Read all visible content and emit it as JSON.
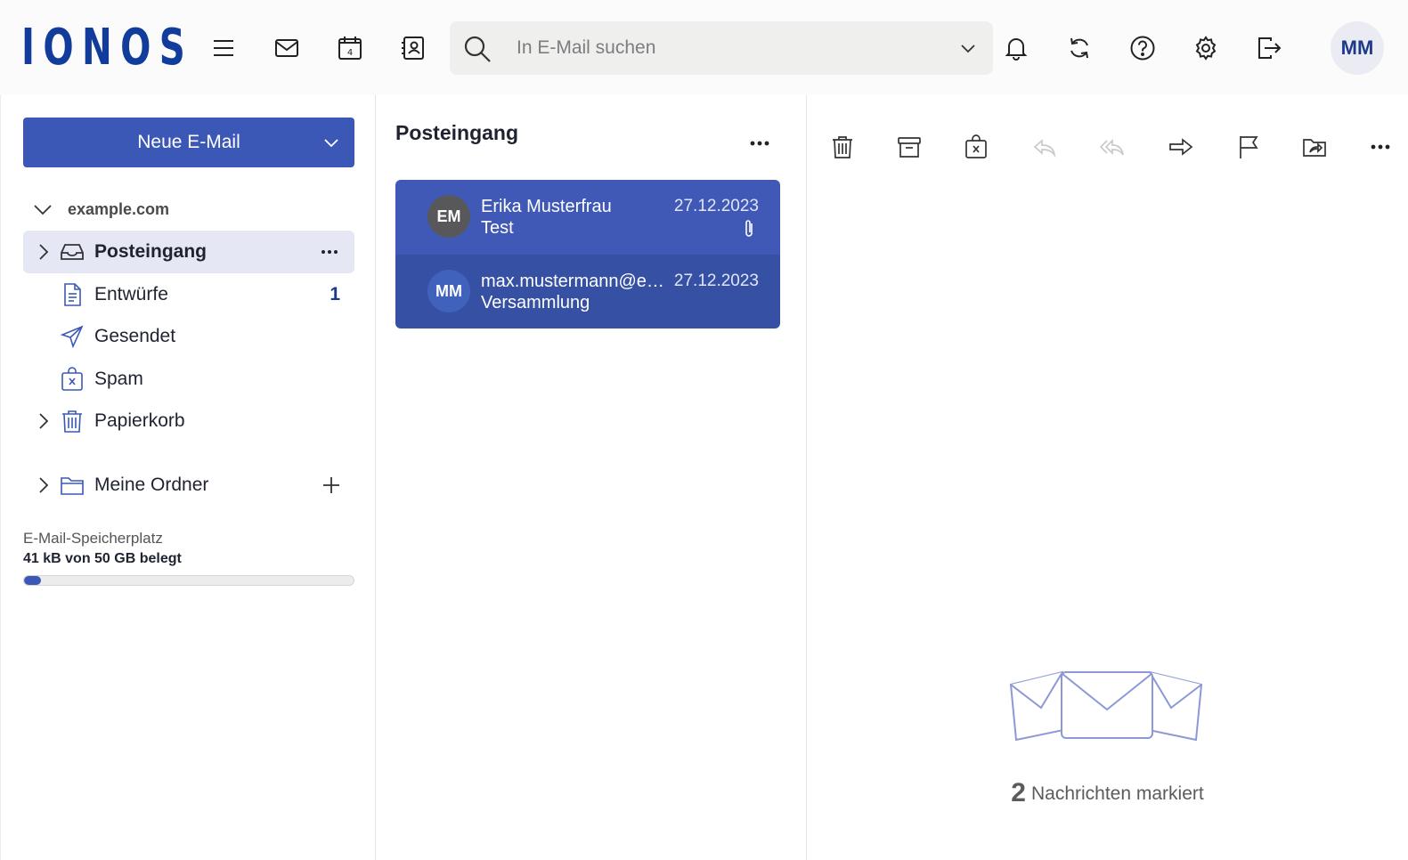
{
  "header": {
    "logo": "IONOS",
    "search_placeholder": "In E-Mail suchen",
    "calendar_day": "4",
    "avatar_initials": "MM",
    "icons": [
      "menu-icon",
      "mail-icon",
      "calendar-icon",
      "contacts-icon",
      "bell-icon",
      "refresh-icon",
      "help-icon",
      "gear-icon",
      "logout-icon"
    ]
  },
  "sidebar": {
    "compose_label": "Neue E-Mail",
    "account": "example.com",
    "folders": [
      {
        "label": "Posteingang",
        "icon": "inbox-icon",
        "active": true,
        "count": ""
      },
      {
        "label": "Entwürfe",
        "icon": "draft-icon",
        "active": false,
        "count": "1"
      },
      {
        "label": "Gesendet",
        "icon": "send-icon",
        "active": false,
        "count": ""
      },
      {
        "label": "Spam",
        "icon": "spam-icon",
        "active": false,
        "count": ""
      },
      {
        "label": "Papierkorb",
        "icon": "trash-icon",
        "active": false,
        "count": ""
      },
      {
        "label": "Meine Ordner",
        "icon": "folder-icon",
        "active": false,
        "count": ""
      }
    ],
    "storage": {
      "label": "E-Mail-Speicherplatz",
      "used_text": "41 kB von 50 GB belegt",
      "fill_percent": 5
    }
  },
  "message_list": {
    "title": "Posteingang",
    "messages": [
      {
        "initials": "EM",
        "from": "Erika Musterfrau",
        "subject": "Test",
        "date": "27.12.2023",
        "has_attachment": true,
        "avatar_color": "#58585a"
      },
      {
        "initials": "MM",
        "from": "max.mustermann@exa...",
        "subject": "Versammlung",
        "date": "27.12.2023",
        "has_attachment": false,
        "avatar_color": "#4062bd"
      }
    ]
  },
  "reader": {
    "toolbar": [
      "delete-icon",
      "archive-icon",
      "spam-icon",
      "reply-icon",
      "reply-all-icon",
      "forward-icon",
      "flag-icon",
      "move-icon",
      "more-icon"
    ],
    "selected_count": "2",
    "selected_text": "Nachrichten markiert"
  },
  "colors": {
    "brand": "#113c9b",
    "accent": "#3b58b6",
    "row_selected_1": "#4059b6",
    "row_selected_2": "#3650a4"
  }
}
